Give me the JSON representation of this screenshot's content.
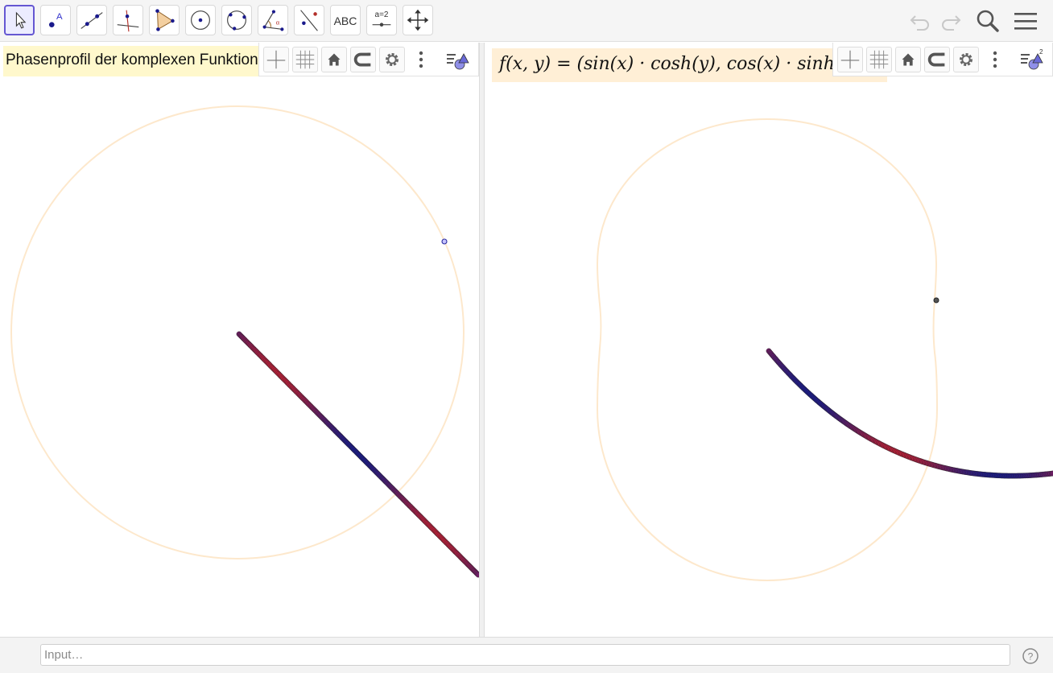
{
  "toolbar": {
    "tools": [
      {
        "id": "move",
        "selected": true
      },
      {
        "id": "point"
      },
      {
        "id": "line"
      },
      {
        "id": "perpendicular-line"
      },
      {
        "id": "polygon"
      },
      {
        "id": "circle-center-point"
      },
      {
        "id": "circle-three-points"
      },
      {
        "id": "angle"
      },
      {
        "id": "reflect-about-line"
      },
      {
        "id": "text",
        "label": "ABC"
      },
      {
        "id": "slider",
        "label": "a=2"
      },
      {
        "id": "move-graphics-view"
      }
    ],
    "right_icons": [
      "undo-icon",
      "redo-icon",
      "search-icon",
      "menu-icon"
    ]
  },
  "view1": {
    "title_text": "Phasenprofil der komplexen Funktion",
    "style_bar": [
      "axes-icon",
      "grid-icon",
      "home-icon",
      "magnet-icon",
      "gear-icon",
      "more-vert-icon",
      "graphics-view-icon"
    ]
  },
  "view2": {
    "formula_text": "f(x, y) = (sin(x) · cosh(y), cos(x) · sinh(y))",
    "style_bar": [
      "axes-icon",
      "grid-icon",
      "home-icon",
      "magnet-icon",
      "gear-icon",
      "more-vert-icon",
      "graphics-view-2-icon"
    ]
  },
  "input_bar": {
    "placeholder": "Input…"
  },
  "colors": {
    "selected_tool_border": "#6557d2",
    "title_bg": "#fff8cc",
    "formula_bg": "#ffefd6",
    "circle_stroke": "#fde8cc",
    "trace_start": "#1b1b8f",
    "trace_end": "#c0203a"
  }
}
